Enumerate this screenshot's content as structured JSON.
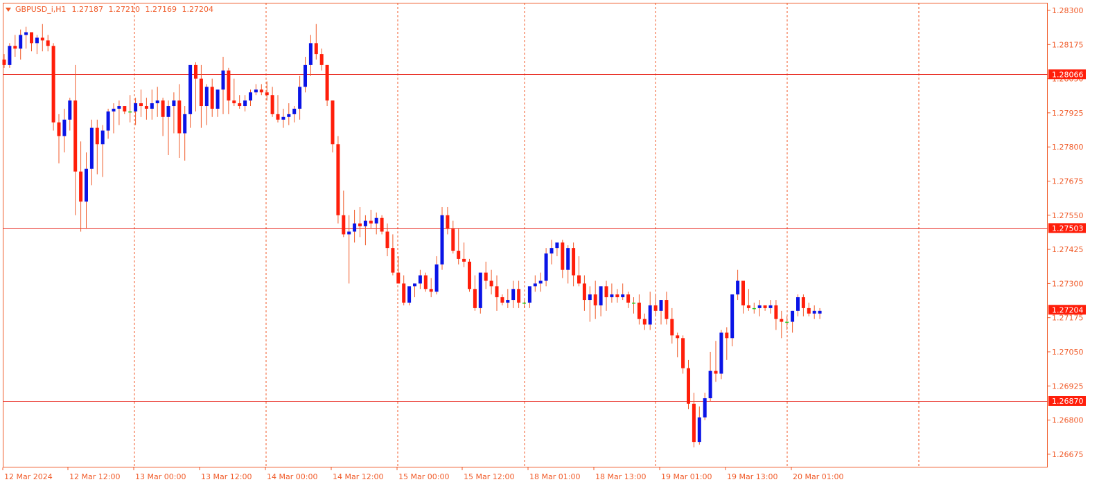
{
  "header": {
    "symbol": "GBPUSD_i,H1",
    "open": "1.27187",
    "high": "1.27210",
    "low": "1.27169",
    "close": "1.27204"
  },
  "colors": {
    "bull": "#0a14e6",
    "bear": "#ff1e0a",
    "neutral": "#22cc22",
    "wick": "#f05a28",
    "grid": "#f05a28",
    "level": "#e8281e",
    "axis_text": "#f05a28",
    "price_tag": "#ff1e0a"
  },
  "chart_data": {
    "type": "candlestick",
    "ylim": [
      1.2661,
      1.2834
    ],
    "y_ticks": [
      "1.28300",
      "1.28175",
      "1.28050",
      "1.27925",
      "1.27800",
      "1.27675",
      "1.27550",
      "1.27425",
      "1.27300",
      "1.27175",
      "1.27050",
      "1.26925",
      "1.26800",
      "1.26675"
    ],
    "x_labels": [
      "12 Mar 2024",
      "12 Mar 12:00",
      "13 Mar 00:00",
      "13 Mar 12:00",
      "14 Mar 00:00",
      "14 Mar 12:00",
      "15 Mar 00:00",
      "15 Mar 12:00",
      "18 Mar 01:00",
      "18 Mar 13:00",
      "19 Mar 01:00",
      "19 Mar 13:00",
      "20 Mar 01:00"
    ],
    "levels": [
      {
        "price": 1.28066,
        "label": "1.28066"
      },
      {
        "price": 1.27503,
        "label": "1.27503"
      },
      {
        "price": 1.2687,
        "label": "1.26870"
      }
    ],
    "current_price": {
      "price": 1.27204,
      "label": "1.27204"
    },
    "candles": [
      [
        1.2812,
        1.2814,
        1.2809,
        1.281
      ],
      [
        1.281,
        1.2818,
        1.2809,
        1.2817
      ],
      [
        1.2817,
        1.2821,
        1.2813,
        1.2816
      ],
      [
        1.2816,
        1.2823,
        1.2812,
        1.2821
      ],
      [
        1.2821,
        1.2824,
        1.2816,
        1.2822
      ],
      [
        1.2822,
        1.2822,
        1.2815,
        1.2818
      ],
      [
        1.2818,
        1.2821,
        1.2814,
        1.282
      ],
      [
        1.282,
        1.2825,
        1.2815,
        1.2819
      ],
      [
        1.2819,
        1.2821,
        1.2815,
        1.2817
      ],
      [
        1.2817,
        1.2818,
        1.2786,
        1.2789
      ],
      [
        1.2789,
        1.2792,
        1.2774,
        1.2784
      ],
      [
        1.2784,
        1.2794,
        1.2778,
        1.279
      ],
      [
        1.279,
        1.2798,
        1.2786,
        1.2797
      ],
      [
        1.2797,
        1.281,
        1.2755,
        1.2771
      ],
      [
        1.2771,
        1.2782,
        1.2749,
        1.276
      ],
      [
        1.276,
        1.2778,
        1.275,
        1.2772
      ],
      [
        1.2772,
        1.279,
        1.2766,
        1.2787
      ],
      [
        1.2787,
        1.279,
        1.277,
        1.2781
      ],
      [
        1.2781,
        1.2788,
        1.2769,
        1.2786
      ],
      [
        1.2786,
        1.2794,
        1.2783,
        1.2793
      ],
      [
        1.2793,
        1.2796,
        1.2785,
        1.2794
      ],
      [
        1.2794,
        1.2797,
        1.2788,
        1.2795
      ],
      [
        1.2795,
        1.2794,
        1.2792,
        1.2793
      ],
      [
        1.2793,
        1.2799,
        1.2789,
        1.2793
      ],
      [
        1.2793,
        1.2798,
        1.2788,
        1.2796
      ],
      [
        1.2796,
        1.2801,
        1.2791,
        1.2795
      ],
      [
        1.2795,
        1.2798,
        1.279,
        1.2794
      ],
      [
        1.2794,
        1.2801,
        1.279,
        1.2796
      ],
      [
        1.2796,
        1.2802,
        1.2791,
        1.2797
      ],
      [
        1.2797,
        1.2798,
        1.2784,
        1.2791
      ],
      [
        1.2791,
        1.2797,
        1.2777,
        1.2795
      ],
      [
        1.2795,
        1.28,
        1.2785,
        1.2797
      ],
      [
        1.2797,
        1.2803,
        1.2776,
        1.2785
      ],
      [
        1.2785,
        1.2795,
        1.2775,
        1.2792
      ],
      [
        1.2792,
        1.2798,
        1.2787,
        1.281
      ],
      [
        1.281,
        1.2811,
        1.2793,
        1.2805
      ],
      [
        1.2805,
        1.281,
        1.2787,
        1.2795
      ],
      [
        1.2795,
        1.2803,
        1.2788,
        1.2802
      ],
      [
        1.2802,
        1.2805,
        1.2791,
        1.2794
      ],
      [
        1.2794,
        1.2801,
        1.2791,
        1.2801
      ],
      [
        1.2801,
        1.2813,
        1.2792,
        1.2808
      ],
      [
        1.2808,
        1.2809,
        1.2792,
        1.2797
      ],
      [
        1.2797,
        1.2805,
        1.2795,
        1.2796
      ],
      [
        1.2796,
        1.2799,
        1.2794,
        1.2795
      ],
      [
        1.2795,
        1.2799,
        1.2793,
        1.2797
      ],
      [
        1.2797,
        1.2801,
        1.2795,
        1.28
      ],
      [
        1.28,
        1.2803,
        1.2799,
        1.2801
      ],
      [
        1.2801,
        1.2803,
        1.2799,
        1.28
      ],
      [
        1.28,
        1.2804,
        1.2797,
        1.2799
      ],
      [
        1.2799,
        1.2802,
        1.2791,
        1.2792
      ],
      [
        1.2792,
        1.2799,
        1.2789,
        1.279
      ],
      [
        1.279,
        1.2794,
        1.2787,
        1.2791
      ],
      [
        1.2791,
        1.2796,
        1.2788,
        1.2792
      ],
      [
        1.2792,
        1.2795,
        1.2789,
        1.2794
      ],
      [
        1.2794,
        1.2806,
        1.279,
        1.2802
      ],
      [
        1.2802,
        1.2813,
        1.28,
        1.281
      ],
      [
        1.281,
        1.2821,
        1.2806,
        1.2818
      ],
      [
        1.2818,
        1.2825,
        1.2812,
        1.2814
      ],
      [
        1.2814,
        1.2816,
        1.2808,
        1.281
      ],
      [
        1.281,
        1.281,
        1.2795,
        1.2797
      ],
      [
        1.2797,
        1.2797,
        1.2778,
        1.2781
      ],
      [
        1.2781,
        1.2784,
        1.2752,
        1.2755
      ],
      [
        1.2755,
        1.2764,
        1.2747,
        1.2748
      ],
      [
        1.2748,
        1.2755,
        1.273,
        1.2749
      ],
      [
        1.2749,
        1.2757,
        1.2745,
        1.2752
      ],
      [
        1.2752,
        1.2758,
        1.2747,
        1.2751
      ],
      [
        1.2751,
        1.2755,
        1.2744,
        1.2753
      ],
      [
        1.2753,
        1.2757,
        1.275,
        1.2752
      ],
      [
        1.2752,
        1.2756,
        1.2748,
        1.2754
      ],
      [
        1.2754,
        1.2755,
        1.2748,
        1.2749
      ],
      [
        1.2749,
        1.2752,
        1.274,
        1.2743
      ],
      [
        1.2743,
        1.2748,
        1.2733,
        1.2734
      ],
      [
        1.2734,
        1.274,
        1.273,
        1.273
      ],
      [
        1.273,
        1.2733,
        1.2722,
        1.2723
      ],
      [
        1.2723,
        1.2728,
        1.2722,
        1.2729
      ],
      [
        1.2729,
        1.273,
        1.2725,
        1.273
      ],
      [
        1.273,
        1.2735,
        1.2728,
        1.2733
      ],
      [
        1.2733,
        1.2734,
        1.2727,
        1.2728
      ],
      [
        1.2728,
        1.2732,
        1.2725,
        1.2727
      ],
      [
        1.2727,
        1.274,
        1.2726,
        1.2737
      ],
      [
        1.2737,
        1.2758,
        1.2735,
        1.2755
      ],
      [
        1.2755,
        1.2758,
        1.2748,
        1.275
      ],
      [
        1.275,
        1.2753,
        1.2741,
        1.2742
      ],
      [
        1.2742,
        1.275,
        1.2737,
        1.2739
      ],
      [
        1.2739,
        1.2745,
        1.2736,
        1.2738
      ],
      [
        1.2738,
        1.2739,
        1.2727,
        1.2728
      ],
      [
        1.2728,
        1.2733,
        1.272,
        1.2721
      ],
      [
        1.2721,
        1.2729,
        1.2719,
        1.2734
      ],
      [
        1.2734,
        1.2738,
        1.2728,
        1.2731
      ],
      [
        1.2731,
        1.2735,
        1.2726,
        1.2729
      ],
      [
        1.2729,
        1.2733,
        1.272,
        1.2725
      ],
      [
        1.2725,
        1.2726,
        1.2722,
        1.2723
      ],
      [
        1.2723,
        1.2728,
        1.2721,
        1.2724
      ],
      [
        1.2724,
        1.2731,
        1.2721,
        1.2728
      ],
      [
        1.2728,
        1.2731,
        1.2721,
        1.2723
      ],
      [
        1.2723,
        1.2724,
        1.2721,
        1.2723
      ],
      [
        1.2723,
        1.2727,
        1.2721,
        1.2729
      ],
      [
        1.2729,
        1.2733,
        1.2727,
        1.273
      ],
      [
        1.273,
        1.2734,
        1.2727,
        1.2731
      ],
      [
        1.2731,
        1.2743,
        1.2729,
        1.2741
      ],
      [
        1.2741,
        1.2746,
        1.2737,
        1.2743
      ],
      [
        1.2743,
        1.2744,
        1.274,
        1.2745
      ],
      [
        1.2745,
        1.2746,
        1.2732,
        1.2735
      ],
      [
        1.2735,
        1.2744,
        1.273,
        1.2743
      ],
      [
        1.2743,
        1.2745,
        1.2729,
        1.2733
      ],
      [
        1.2733,
        1.274,
        1.2729,
        1.273
      ],
      [
        1.273,
        1.2733,
        1.272,
        1.2724
      ],
      [
        1.2724,
        1.2729,
        1.2716,
        1.2726
      ],
      [
        1.2726,
        1.2731,
        1.2717,
        1.2722
      ],
      [
        1.2722,
        1.2729,
        1.2718,
        1.2729
      ],
      [
        1.2729,
        1.2731,
        1.272,
        1.2725
      ],
      [
        1.2725,
        1.273,
        1.2723,
        1.2726
      ],
      [
        1.2726,
        1.2728,
        1.2723,
        1.2725
      ],
      [
        1.2725,
        1.273,
        1.2724,
        1.2726
      ],
      [
        1.2726,
        1.2727,
        1.2721,
        1.2723
      ],
      [
        1.2723,
        1.2725,
        1.2719,
        1.2723
      ],
      [
        1.2723,
        1.2726,
        1.2715,
        1.2717
      ],
      [
        1.2717,
        1.2719,
        1.2713,
        1.2715
      ],
      [
        1.2715,
        1.2727,
        1.2713,
        1.2722
      ],
      [
        1.2722,
        1.2726,
        1.2718,
        1.272
      ],
      [
        1.272,
        1.2723,
        1.2715,
        1.2724
      ],
      [
        1.2724,
        1.2727,
        1.2715,
        1.2717
      ],
      [
        1.2717,
        1.2721,
        1.2708,
        1.2711
      ],
      [
        1.2711,
        1.2712,
        1.2703,
        1.271
      ],
      [
        1.271,
        1.2711,
        1.2697,
        1.2699
      ],
      [
        1.2699,
        1.2702,
        1.2684,
        1.2686
      ],
      [
        1.2686,
        1.269,
        1.267,
        1.2672
      ],
      [
        1.2672,
        1.2685,
        1.2671,
        1.2681
      ],
      [
        1.2681,
        1.269,
        1.268,
        1.2688
      ],
      [
        1.2688,
        1.2705,
        1.2687,
        1.2698
      ],
      [
        1.2698,
        1.2709,
        1.2694,
        1.2697
      ],
      [
        1.2697,
        1.2713,
        1.2695,
        1.2712
      ],
      [
        1.2712,
        1.2714,
        1.2702,
        1.271
      ],
      [
        1.271,
        1.2726,
        1.2707,
        1.2726
      ],
      [
        1.2726,
        1.2735,
        1.2724,
        1.2731
      ],
      [
        1.2731,
        1.2731,
        1.2719,
        1.2722
      ],
      [
        1.2722,
        1.2728,
        1.272,
        1.2721
      ],
      [
        1.2721,
        1.2723,
        1.2719,
        1.2721
      ],
      [
        1.2721,
        1.2724,
        1.2718,
        1.2722
      ],
      [
        1.2722,
        1.2722,
        1.272,
        1.2721
      ],
      [
        1.2721,
        1.2724,
        1.2719,
        1.2722
      ],
      [
        1.2722,
        1.2724,
        1.2713,
        1.2717
      ],
      [
        1.2717,
        1.272,
        1.271,
        1.2716
      ],
      [
        1.2716,
        1.2718,
        1.2713,
        1.2716
      ],
      [
        1.2716,
        1.272,
        1.2712,
        1.272
      ],
      [
        1.272,
        1.2726,
        1.2718,
        1.2725
      ],
      [
        1.2725,
        1.2726,
        1.2718,
        1.2721
      ],
      [
        1.2721,
        1.2723,
        1.2718,
        1.2719
      ],
      [
        1.2719,
        1.2722,
        1.2717,
        1.272
      ],
      [
        1.2719,
        1.2721,
        1.2717,
        1.272
      ]
    ]
  }
}
